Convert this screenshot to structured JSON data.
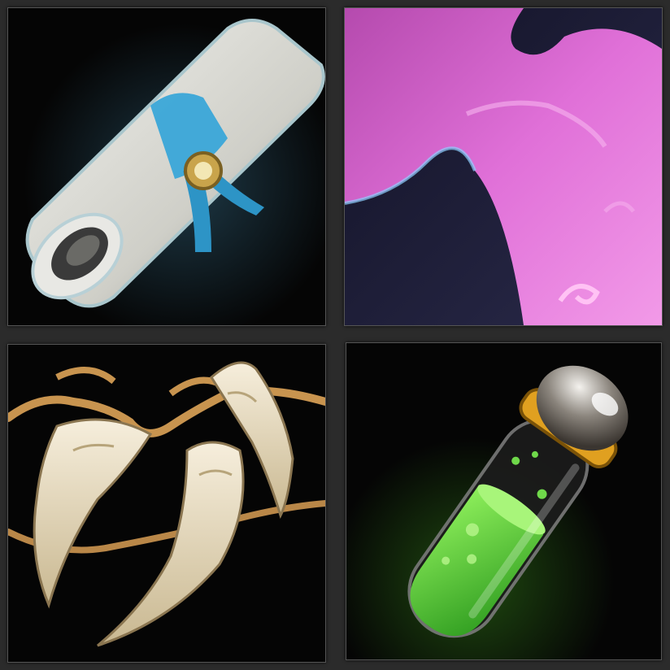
{
  "items": [
    {
      "id": "scroll",
      "icon": "scroll-icon"
    },
    {
      "id": "cloth",
      "icon": "pink-cloth-icon"
    },
    {
      "id": "fangs",
      "icon": "fang-necklace-icon"
    },
    {
      "id": "potion",
      "icon": "green-vial-icon"
    }
  ],
  "colors": {
    "frame": "#555555",
    "tile_background": "#050505",
    "page_background": "#2b2b2b",
    "scroll_ribbon": "#3aa7d8",
    "cloth": "#e070d8",
    "fang": "#e8dcb8",
    "cord": "#c8944f",
    "liquid": "#4fd23a",
    "cap_ring": "#e0a020"
  }
}
